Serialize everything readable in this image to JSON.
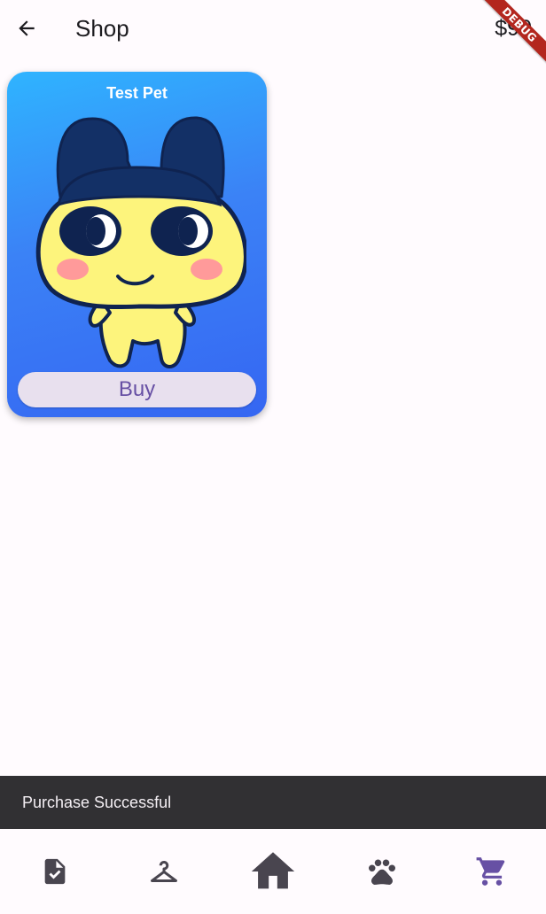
{
  "app_bar": {
    "title": "Shop",
    "balance": "$90",
    "back_icon": "arrow-back-icon",
    "debug_badge": "DEBUG"
  },
  "shop": {
    "items": [
      {
        "name": "Test Pet",
        "buy_label": "Buy",
        "image": "cartoon-pet-character"
      }
    ]
  },
  "snackbar": {
    "message": "Purchase Successful"
  },
  "bottom_nav": {
    "items": [
      {
        "icon": "task-document-icon",
        "selected": false
      },
      {
        "icon": "hanger-icon",
        "selected": false
      },
      {
        "icon": "home-icon",
        "selected": false
      },
      {
        "icon": "paw-icon",
        "selected": false
      },
      {
        "icon": "shopping-cart-icon",
        "selected": true
      }
    ]
  },
  "colors": {
    "accent": "#6750a4",
    "card_gradient_top": "#2fb4ff",
    "card_gradient_bottom": "#3566f2",
    "snackbar_bg": "#313033",
    "nav_icon": "#49454f",
    "debug_ribbon": "#b3261e"
  }
}
